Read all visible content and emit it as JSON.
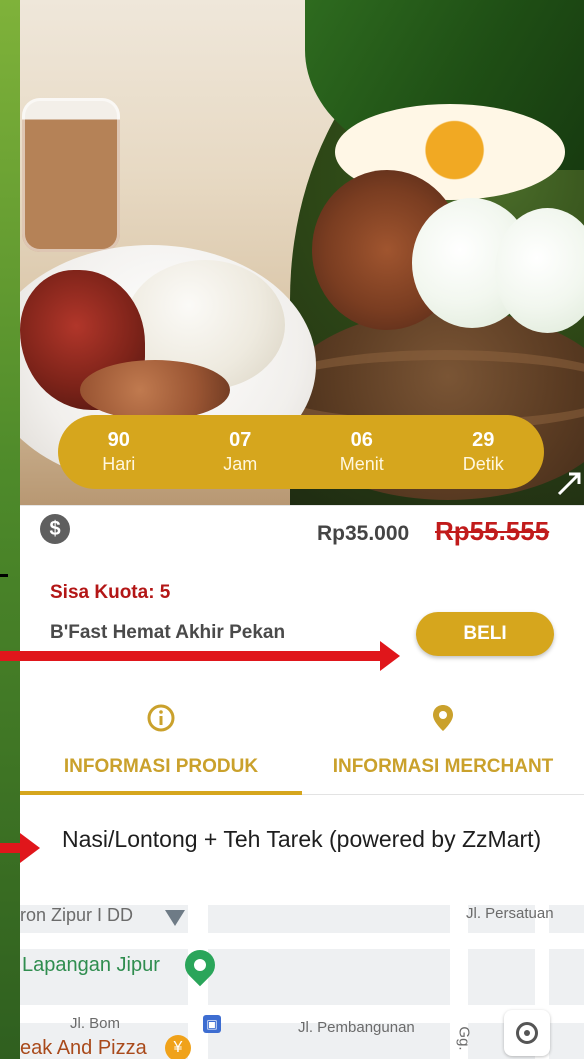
{
  "countdown": [
    {
      "value": "90",
      "label": "Hari"
    },
    {
      "value": "07",
      "label": "Jam"
    },
    {
      "value": "06",
      "label": "Menit"
    },
    {
      "value": "29",
      "label": "Detik"
    }
  ],
  "price": {
    "current": "Rp35.000",
    "original": "Rp55.555",
    "icon": "dollar-icon"
  },
  "promo": {
    "quota": "Sisa Kuota: 5",
    "name": "B'Fast Hemat Akhir Pekan",
    "buy_label": "BELI"
  },
  "tabs": [
    {
      "label": "INFORMASI PRODUK",
      "icon": "info-icon",
      "active": true
    },
    {
      "label": "INFORMASI MERCHANT",
      "icon": "location-pin-icon",
      "active": false
    }
  ],
  "description": "Nasi/Lontong + Teh Tarek (powered by ZzMart)",
  "map": {
    "labels": {
      "top_left": "ron Zipur I DD",
      "top_right": "Jl. Persatuan",
      "place": "Lapangan Jipur",
      "street1": "Jl. Bom",
      "street2": "Jl. Pembangunan",
      "side": "Gg.",
      "food": "eak And Pizza"
    }
  },
  "colors": {
    "accent": "#d6a61d",
    "danger": "#c11b1b",
    "arrow": "#e0161b"
  }
}
